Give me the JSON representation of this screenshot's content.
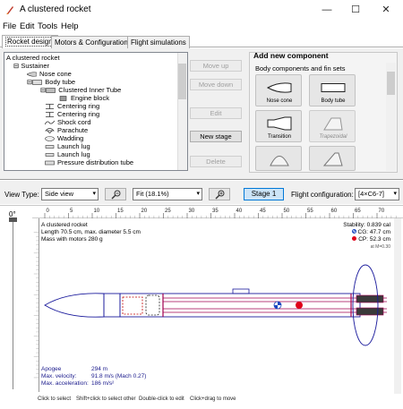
{
  "window": {
    "title": "A clustered rocket",
    "controls": {
      "minimize": "—",
      "maximize": "☐",
      "close": "✕"
    }
  },
  "menu": [
    "File",
    "Edit",
    "Tools",
    "Help"
  ],
  "tabs": [
    "Rocket design",
    "Motors & Configuration",
    "Flight simulations"
  ],
  "tree": [
    {
      "label": "A clustered rocket",
      "icon": "none"
    },
    {
      "label": "Sustainer",
      "icon": "expander"
    },
    {
      "label": "Nose cone",
      "icon": "nose-cone-icon"
    },
    {
      "label": "Body tube",
      "icon": "body-tube-icon"
    },
    {
      "label": "Clustered Inner Tube",
      "icon": "inner-tube-icon"
    },
    {
      "label": "Engine block",
      "icon": "engine-block-icon"
    },
    {
      "label": "Centering ring",
      "icon": "centering-ring-icon"
    },
    {
      "label": "Centering ring",
      "icon": "centering-ring-icon"
    },
    {
      "label": "Shock cord",
      "icon": "shock-cord-icon"
    },
    {
      "label": "Parachute",
      "icon": "parachute-icon"
    },
    {
      "label": "Wadding",
      "icon": "wadding-icon"
    },
    {
      "label": "Launch lug",
      "icon": "launch-lug-icon"
    },
    {
      "label": "Launch lug",
      "icon": "launch-lug-icon"
    },
    {
      "label": "Pressure distribution tube",
      "icon": "tube-icon"
    }
  ],
  "actions": {
    "move_up": "Move up",
    "move_down": "Move down",
    "edit": "Edit",
    "new_stage": "New stage",
    "delete": "Delete"
  },
  "add_panel": {
    "title": "Add new component",
    "subtitle": "Body components and fin sets",
    "components": [
      "Nose cone",
      "Body tube",
      "Transition",
      "Trapezoidal",
      "",
      ""
    ]
  },
  "toolbar": {
    "view_type_label": "View Type:",
    "view_type_value": "Side view",
    "zoom_value": "Fit (18.1%)",
    "stage_button": "Stage 1",
    "flight_config_label": "Flight configuration:",
    "flight_config_value": "[4×C6-7]"
  },
  "canvas": {
    "angle": "0°",
    "ruler_ticks": [
      "0",
      "5",
      "10",
      "15",
      "20",
      "25",
      "30",
      "35",
      "40",
      "45",
      "50",
      "55",
      "60",
      "65",
      "70"
    ],
    "rocket_name": "A clustered rocket",
    "rocket_length": "Length 70.5 cm, max. diameter 5.5 cm",
    "rocket_mass": "Mass with motors 280 g",
    "stability": "Stability: 0.839 cal",
    "cg": "CG: 47.7 cm",
    "cp": "CP: 52.3 cm",
    "mach": "at M=0.30",
    "apogee_label": "Apogee",
    "apogee_value": "294 m",
    "velocity_label": "Max. velocity:",
    "velocity_value": "91.8 m/s  (Mach 0.27)",
    "accel_label": "Max. acceleration:",
    "accel_value": "186 m/s²"
  },
  "status": {
    "hint1": "Click to select",
    "hint2": "Shift+click to select other",
    "hint3": "Double-click to edit",
    "hint4": "Click+drag to move"
  },
  "colors": {
    "rocket_outline": "#1a1a9c",
    "tube_line": "#a00050",
    "cp_marker": "#e0001a",
    "cg_marker": "#1a48c0",
    "motor_fill": "#3a3a3a",
    "accent_blue": "#0078d7"
  }
}
